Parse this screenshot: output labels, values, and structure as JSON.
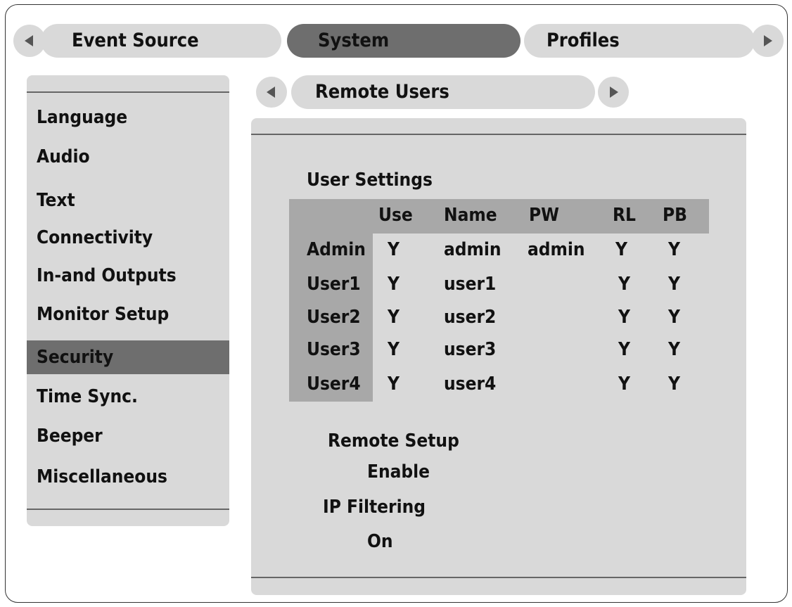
{
  "top_tabs": {
    "prev_icon": "triangle-left-icon",
    "next_icon": "triangle-right-icon",
    "items": [
      {
        "label": "Event Source"
      },
      {
        "label": "System"
      },
      {
        "label": "Profiles"
      }
    ],
    "active": "System"
  },
  "sidebar": {
    "items": [
      {
        "label": "Language"
      },
      {
        "label": "Audio"
      },
      {
        "label": "Text"
      },
      {
        "label": "Connectivity"
      },
      {
        "label": "In-and Outputs"
      },
      {
        "label": "Monitor Setup"
      },
      {
        "label": "Security"
      },
      {
        "label": "Time Sync."
      },
      {
        "label": "Beeper"
      },
      {
        "label": "Miscellaneous"
      }
    ],
    "selected": "Security"
  },
  "subpage": {
    "title": "Remote Users",
    "prev_icon": "triangle-left-icon",
    "next_icon": "triangle-right-icon"
  },
  "user_settings": {
    "heading": "User Settings",
    "columns": [
      "Use",
      "Name",
      "PW",
      "RL",
      "PB"
    ],
    "rows": [
      {
        "user": "Admin",
        "use": "Y",
        "name": "admin",
        "pw": "admin",
        "rl": "Y",
        "pb": "Y"
      },
      {
        "user": "User1",
        "use": "Y",
        "name": "user1",
        "pw": "",
        "rl": "Y",
        "pb": "Y"
      },
      {
        "user": "User2",
        "use": "Y",
        "name": "user2",
        "pw": "",
        "rl": "Y",
        "pb": "Y"
      },
      {
        "user": "User3",
        "use": "Y",
        "name": "user3",
        "pw": "",
        "rl": "Y",
        "pb": "Y"
      },
      {
        "user": "User4",
        "use": "Y",
        "name": "user4",
        "pw": "",
        "rl": "Y",
        "pb": "Y"
      }
    ]
  },
  "remote_setup": {
    "label": "Remote Setup",
    "value": "Enable"
  },
  "ip_filtering": {
    "label": "IP Filtering",
    "value": "On"
  },
  "colors": {
    "panel": "#d9d9d9",
    "selected": "#6e6e6e",
    "table_header": "#a8a8a8"
  }
}
